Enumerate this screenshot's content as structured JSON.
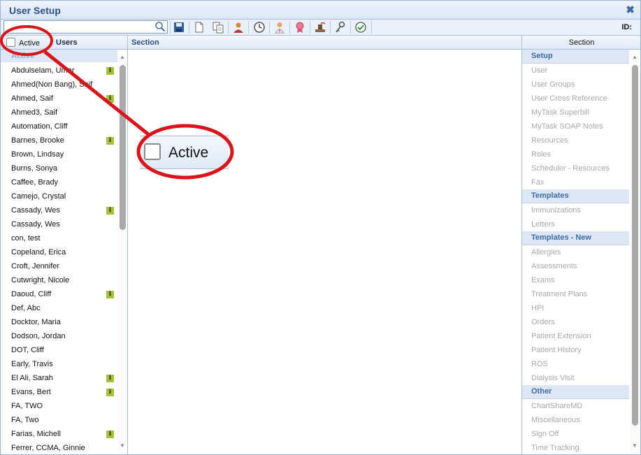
{
  "window": {
    "title": "User Setup",
    "close_glyph": "✖"
  },
  "toolbar": {
    "search_value": "",
    "search_icon": "search-icon",
    "buttons": [
      {
        "icon": "save-icon"
      },
      {
        "icon": "new-document-icon"
      },
      {
        "icon": "copy-icon"
      },
      {
        "icon": "user-icon"
      },
      {
        "icon": "clock-icon"
      },
      {
        "icon": "provider-icon"
      },
      {
        "icon": "award-icon"
      },
      {
        "icon": "signature-stamp-icon"
      },
      {
        "icon": "key-icon"
      },
      {
        "icon": "checkmark-icon"
      }
    ],
    "id_label": "ID:"
  },
  "headers": {
    "active_label": "Active",
    "users_label": "Users",
    "section_label": "Section",
    "right_section_label": "Section"
  },
  "users": {
    "group_label": "Active",
    "items": [
      {
        "name": "Abdulselam, Umar",
        "info": true
      },
      {
        "name": "Ahmed(Non Bang), Saif",
        "info": false
      },
      {
        "name": "Ahmed, Saif",
        "info": true
      },
      {
        "name": "Ahmed3, Saif",
        "info": false
      },
      {
        "name": "Automation, Cliff",
        "info": false
      },
      {
        "name": "Barnes, Brooke",
        "info": true
      },
      {
        "name": "Brown, Lindsay",
        "info": false
      },
      {
        "name": "Burns, Sonya",
        "info": false
      },
      {
        "name": "Caffee, Brady",
        "info": false
      },
      {
        "name": "Camejo, Crystal",
        "info": false
      },
      {
        "name": "Cassady, Wes",
        "info": true
      },
      {
        "name": "Cassady, Wes",
        "info": false
      },
      {
        "name": "con, test",
        "info": false
      },
      {
        "name": "Copeland, Erica",
        "info": false
      },
      {
        "name": "Croft, Jennifer",
        "info": false
      },
      {
        "name": "Cutwright, Nicole",
        "info": false
      },
      {
        "name": "Daoud, Cliff",
        "info": true
      },
      {
        "name": "Def, Abc",
        "info": false
      },
      {
        "name": "Docktor, Maria",
        "info": false
      },
      {
        "name": "Dodson, Jordan",
        "info": false
      },
      {
        "name": "DOT, Cliff",
        "info": false
      },
      {
        "name": "Early, Travis",
        "info": false
      },
      {
        "name": "El Ali, Sarah",
        "info": true
      },
      {
        "name": "Evans, Bert",
        "info": true
      },
      {
        "name": "FA, TWO",
        "info": false
      },
      {
        "name": "FA, Two",
        "info": false
      },
      {
        "name": "Farias, Michell",
        "info": true
      },
      {
        "name": "Ferrer, CCMA, Ginnie",
        "info": false
      }
    ],
    "info_badge_glyph": "i"
  },
  "sections": [
    {
      "type": "header",
      "label": "Setup"
    },
    {
      "type": "item",
      "label": "User"
    },
    {
      "type": "item",
      "label": "User Groups"
    },
    {
      "type": "item",
      "label": "User Cross Reference"
    },
    {
      "type": "item",
      "label": "MyTask Superbill"
    },
    {
      "type": "item",
      "label": "MyTask SOAP Notes"
    },
    {
      "type": "item",
      "label": "Resources"
    },
    {
      "type": "item",
      "label": "Roles"
    },
    {
      "type": "item",
      "label": "Scheduler - Resources"
    },
    {
      "type": "item",
      "label": "Fax"
    },
    {
      "type": "header",
      "label": "Templates"
    },
    {
      "type": "item",
      "label": "Immunizations"
    },
    {
      "type": "item",
      "label": "Letters"
    },
    {
      "type": "header",
      "label": "Templates - New"
    },
    {
      "type": "item",
      "label": "Allergies"
    },
    {
      "type": "item",
      "label": "Assessments"
    },
    {
      "type": "item",
      "label": "Exams"
    },
    {
      "type": "item",
      "label": "Treatment Plans"
    },
    {
      "type": "item",
      "label": "HPI"
    },
    {
      "type": "item",
      "label": "Orders"
    },
    {
      "type": "item",
      "label": "Patient Extension"
    },
    {
      "type": "item",
      "label": "Patient History"
    },
    {
      "type": "item",
      "label": "ROS"
    },
    {
      "type": "item",
      "label": "Dialysis Visit"
    },
    {
      "type": "header",
      "label": "Other"
    },
    {
      "type": "item",
      "label": "ChartShareMD"
    },
    {
      "type": "item",
      "label": "Miscellaneous"
    },
    {
      "type": "item",
      "label": "Sign Off"
    },
    {
      "type": "item",
      "label": "Time Tracking"
    }
  ],
  "annotation": {
    "zoom_label": "Active",
    "color": "#d9141b"
  },
  "colors": {
    "title_text": "#2a4f86",
    "section_header_text": "#3d6aa8",
    "disabled_item_text": "#a8a8a8",
    "info_badge": "#a6c23a"
  }
}
